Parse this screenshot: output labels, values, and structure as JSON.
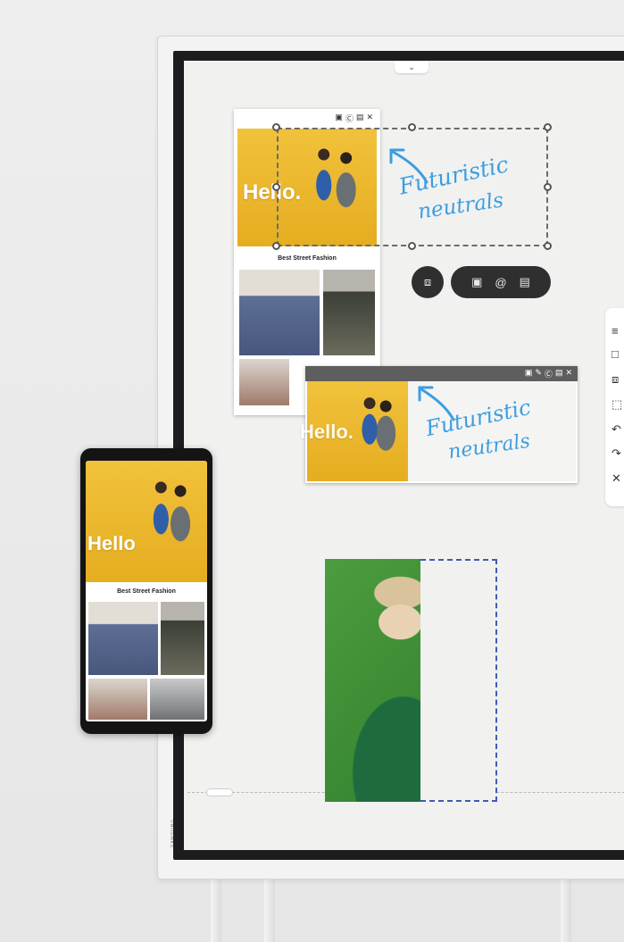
{
  "board": {
    "brand": "SAMSUNG",
    "pull_tab_icon": "chevron-down-icon"
  },
  "web_card": {
    "hero_text": "Hello.",
    "title": "Best Street Fashion",
    "toolbar_icons": [
      "capture-icon",
      "copy-icon",
      "save-icon",
      "close-icon"
    ]
  },
  "annotation": {
    "line1": "Futuristic",
    "line2": "neutrals"
  },
  "capture_actions": {
    "crop_icon": "crop-capture-icon",
    "items": [
      "camera-icon",
      "email-icon",
      "document-icon"
    ]
  },
  "capture_window": {
    "hero_text": "Hello.",
    "toolbar_icons": [
      "capture-icon",
      "edit-icon",
      "copy-icon",
      "save-icon",
      "close-icon"
    ]
  },
  "side_toolbar": {
    "items": [
      "menu-icon",
      "note-icon",
      "layers-icon",
      "select-icon",
      "undo-icon",
      "redo-icon",
      "close-icon"
    ]
  },
  "phone": {
    "hero_text": "Hello",
    "title": "Best Street Fashion"
  }
}
